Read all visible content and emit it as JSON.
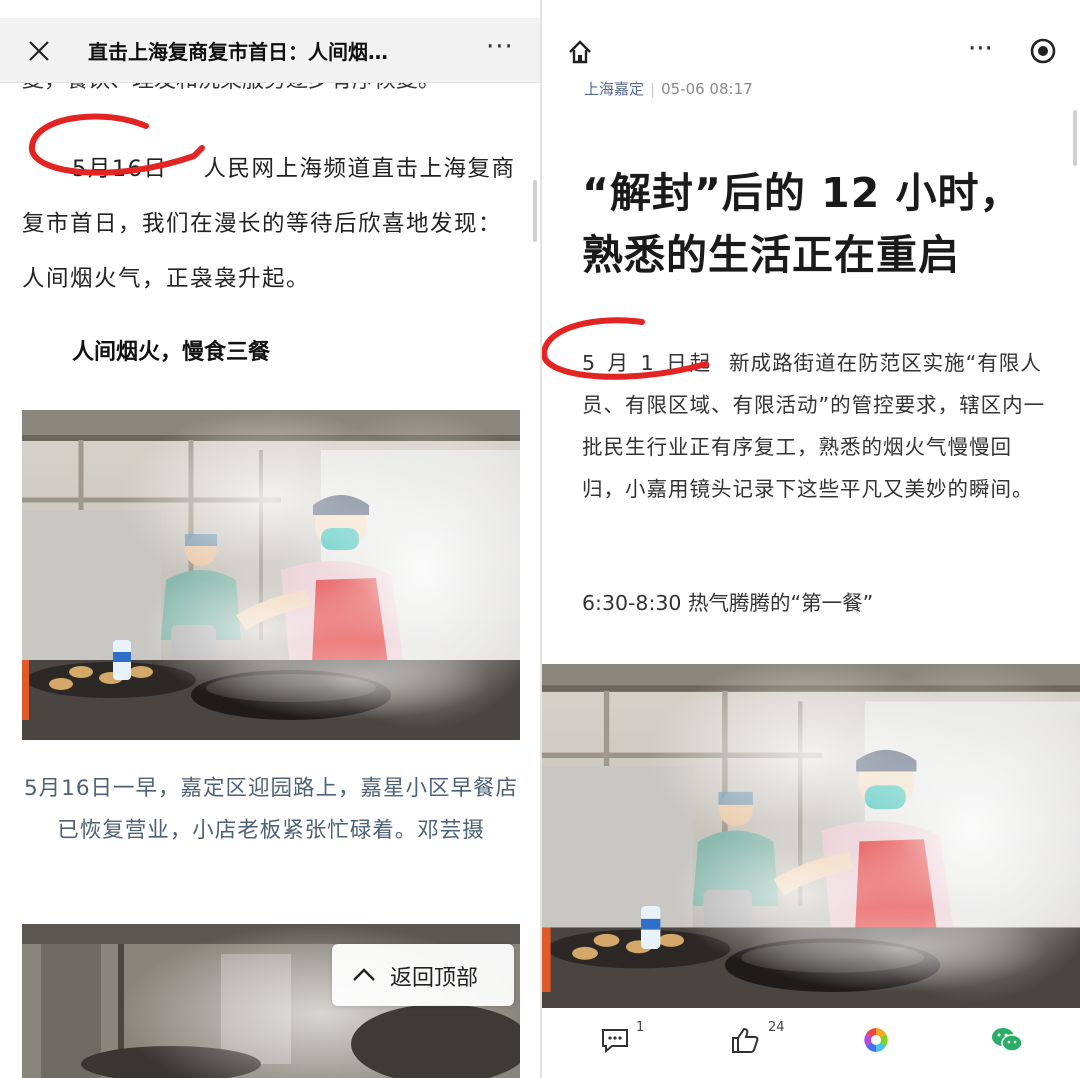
{
  "left": {
    "header": {
      "title": "直击上海复商复市首日：人间烟…",
      "more": "···"
    },
    "prev_line": "复，餐饮、理发和洗染服务逐步有序恢复。",
    "paragraph": {
      "date": "5月16日",
      "text_line1": "人民网上海频道直击上海复商",
      "text_rest": "复市首日，我们在漫长的等待后欣喜地发现：人间烟火气，正袅袅升起。"
    },
    "section_title": "人间烟火，慢食三餐",
    "caption": "5月16日一早，嘉定区迎园路上，嘉星小区早餐店已恢复营业，小店老板紧张忙碌着。邓芸摄",
    "back_to_top": "返回顶部"
  },
  "right": {
    "header": {
      "more": "···"
    },
    "source": {
      "author": "上海嘉定",
      "time": "05-06 08:17"
    },
    "headline_line1": "“解封”后的 12 小时，",
    "headline_line2": "熟悉的生活正在重启",
    "paragraph": {
      "date": "5 月 1 日起",
      "text": "新成路街道在防范区实施“有限人员、有限区域、有限活动”的管控要求，辖区内一批民生行业正有序复工，熟悉的烟火气慢慢回归，小嘉用镜头记录下这些平凡又美妙的瞬间。"
    },
    "subtitle": "6:30-8:30 热气腾腾的“第一餐”",
    "bottom_bar": {
      "comments": "1",
      "likes": "24"
    }
  },
  "colors": {
    "red_mark": "#e42323",
    "wechat_green": "#2aae67",
    "caption_blue": "#4d6276"
  }
}
